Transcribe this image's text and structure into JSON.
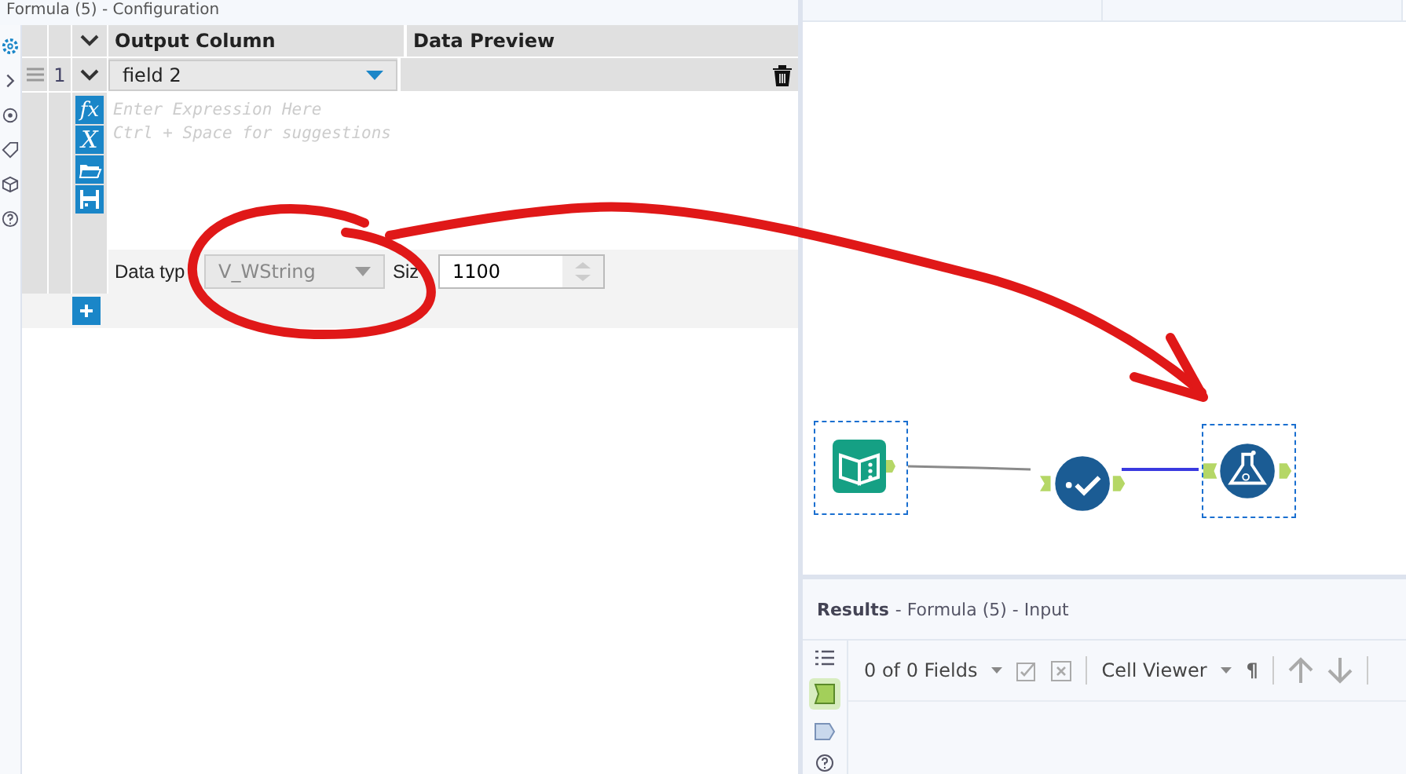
{
  "config_panel": {
    "title": "Formula (5) - Configuration"
  },
  "side_icons": [
    {
      "kind": "gear",
      "selected": true
    },
    {
      "kind": "chevron",
      "selected": false
    },
    {
      "kind": "target",
      "selected": false
    },
    {
      "kind": "tag",
      "selected": false
    },
    {
      "kind": "cube",
      "selected": false
    },
    {
      "kind": "help",
      "selected": false
    }
  ],
  "grid": {
    "columns": [
      "Output Column",
      "Data Preview"
    ],
    "rows": [
      {
        "number": "1",
        "output_column": "field 2",
        "expression_buttons": [
          {
            "kind": "function",
            "glyph": "fx"
          },
          {
            "kind": "variable",
            "glyph": "X"
          }
        ],
        "expression_placeholder": "Enter Expression Here\nCtrl + Space for suggestions",
        "data_type": {
          "label": "Data typ",
          "value": "V_WString",
          "disabled": true
        },
        "size": {
          "label": "Siz",
          "value": "1100"
        }
      }
    ]
  },
  "canvas": {
    "nodes": [
      {
        "kind": "input",
        "selected": true
      },
      {
        "kind": "select",
        "selected": false
      },
      {
        "kind": "formula",
        "selected": true
      }
    ],
    "connections": [
      {
        "kind": "plain"
      },
      {
        "kind": "highlighted"
      }
    ]
  },
  "results": {
    "title": "Results",
    "subtitle": "- Formula (5) - Input",
    "fields": "0 of 0 Fields",
    "viewer": "Cell Viewer",
    "wrap_glyph": "¶"
  }
}
